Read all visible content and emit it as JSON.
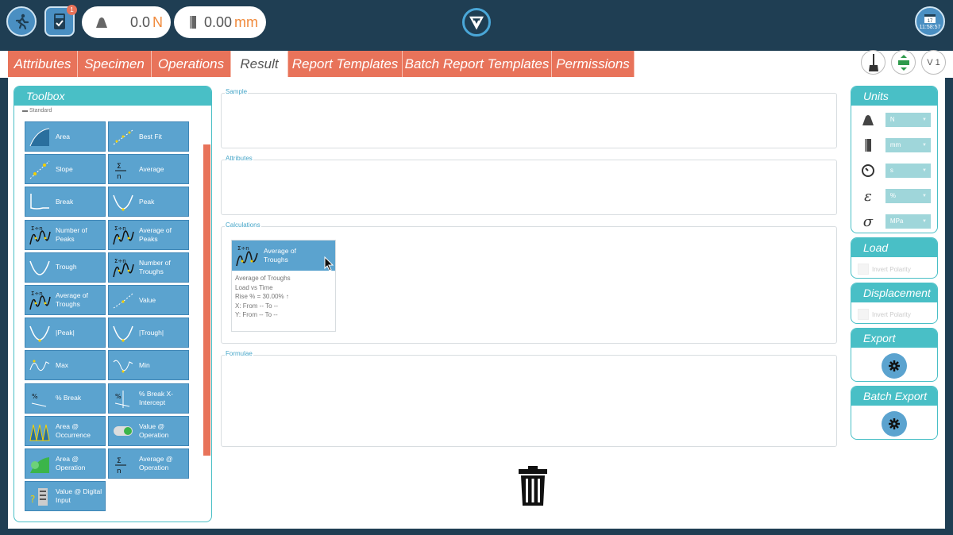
{
  "topbar": {
    "load_value": "0.0",
    "load_unit": "N",
    "disp_value": "0.00",
    "disp_unit": "mm",
    "notification_count": "1",
    "clock_day": "17",
    "clock_time": "11:58:57"
  },
  "tabs": [
    {
      "label": "Attributes"
    },
    {
      "label": "Specimen"
    },
    {
      "label": "Operations"
    },
    {
      "label": "Result",
      "active": true
    },
    {
      "label": "Report Templates"
    },
    {
      "label": "Batch Report Templates"
    },
    {
      "label": "Permissions"
    }
  ],
  "toolbar_right": {
    "version_label": "V 1"
  },
  "toolbox": {
    "title": "Toolbox",
    "section": "Standard",
    "items": [
      {
        "label": "Area",
        "icon": "area-icon"
      },
      {
        "label": "Best Fit",
        "icon": "best-fit-icon"
      },
      {
        "label": "Slope",
        "icon": "slope-icon"
      },
      {
        "label": "Average",
        "icon": "average-icon"
      },
      {
        "label": "Break",
        "icon": "break-icon"
      },
      {
        "label": "Peak",
        "icon": "peak-icon"
      },
      {
        "label": "Number of Peaks",
        "icon": "number-of-peaks-icon"
      },
      {
        "label": "Average of Peaks",
        "icon": "average-of-peaks-icon"
      },
      {
        "label": "Trough",
        "icon": "trough-icon"
      },
      {
        "label": "Number of Troughs",
        "icon": "number-of-troughs-icon"
      },
      {
        "label": "Average of Troughs",
        "icon": "average-of-troughs-icon"
      },
      {
        "label": "Value",
        "icon": "value-icon"
      },
      {
        "label": "|Peak|",
        "icon": "abs-peak-icon"
      },
      {
        "label": "|Trough|",
        "icon": "abs-trough-icon"
      },
      {
        "label": "Max",
        "icon": "max-icon"
      },
      {
        "label": "Min",
        "icon": "min-icon"
      },
      {
        "label": "% Break",
        "icon": "percent-break-icon"
      },
      {
        "label": "% Break X-Intercept",
        "icon": "percent-break-x-intercept-icon"
      },
      {
        "label": "Area @ Occurrence",
        "icon": "area-at-occurrence-icon"
      },
      {
        "label": "Value @ Operation",
        "icon": "value-at-operation-icon"
      },
      {
        "label": "Area @ Operation",
        "icon": "area-at-operation-icon"
      },
      {
        "label": "Average @ Operation",
        "icon": "average-at-operation-icon"
      },
      {
        "label": "Value @ Digital Input",
        "icon": "value-at-digital-input-icon"
      }
    ]
  },
  "panels": {
    "sample": "Sample",
    "attributes": "Attributes",
    "calculations": "Calculations",
    "formulae": "Formulae"
  },
  "calculation_card": {
    "title": "Average of Troughs",
    "lines": [
      "Average of Troughs",
      "Load vs Time",
      "Rise % = 30.00% ↑",
      "X: From -- To --",
      "Y: From -- To --"
    ]
  },
  "units": {
    "title": "Units",
    "rows": [
      {
        "icon": "weight-icon",
        "value": "N"
      },
      {
        "icon": "length-icon",
        "value": "mm"
      },
      {
        "icon": "clock-icon",
        "value": "s"
      },
      {
        "icon": "strain-icon",
        "symbol": "ε",
        "value": "%"
      },
      {
        "icon": "stress-icon",
        "symbol": "σ",
        "value": "MPa"
      }
    ]
  },
  "load_panel": {
    "title": "Load",
    "checkbox_label": "Invert Polarity"
  },
  "displacement_panel": {
    "title": "Displacement",
    "checkbox_label": "Invert Polarity"
  },
  "export_panel": {
    "title": "Export"
  },
  "batch_export_panel": {
    "title": "Batch Export"
  },
  "colors": {
    "header_bg": "#1f3e53",
    "tab_orange": "#e8735a",
    "teal": "#49bfc6",
    "tool_blue": "#5ba3cf",
    "accent_orange": "#f08a3c"
  }
}
